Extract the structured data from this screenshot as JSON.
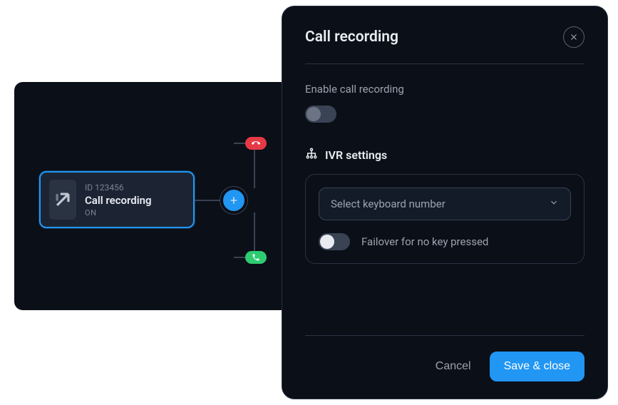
{
  "node": {
    "id": "ID 123456",
    "title": "Call recording",
    "status": "ON"
  },
  "modal": {
    "title": "Call recording",
    "enable_label": "Enable call recording",
    "enable_value": false,
    "ivr_heading": "IVR  settings",
    "select_placeholder": "Select  keyboard number",
    "failover_label": "Failover for no key pressed",
    "failover_value": false,
    "cancel_label": "Cancel",
    "save_label": "Save & close"
  }
}
